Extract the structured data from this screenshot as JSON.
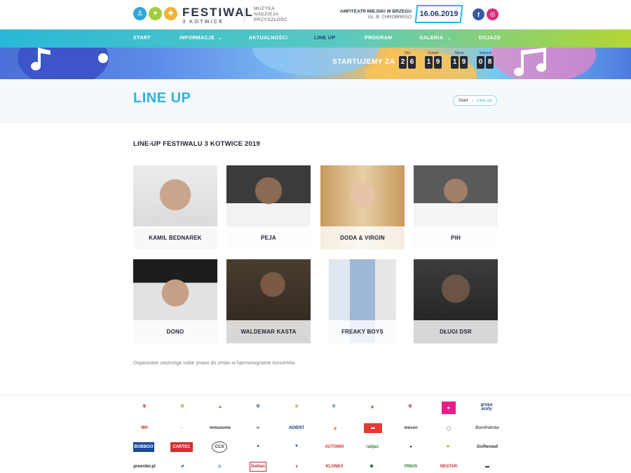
{
  "header": {
    "brand_title": "FESTIWAL",
    "brand_subtitle": "3 KOTWICE",
    "motto_lines": [
      "MUZYKA",
      "NADZIEJA",
      "PRZYSZŁOŚĆ"
    ],
    "venue_name": "AMFITEATR MIEJSKI W BRZEGU",
    "venue_address": "UL. B. CHROBREGO",
    "date": "16.06.2019",
    "social": [
      "facebook-icon",
      "instagram-icon"
    ]
  },
  "nav": {
    "items": [
      {
        "label": "START"
      },
      {
        "label": "INFORMACJE"
      },
      {
        "label": "AKTUALNOŚCI"
      },
      {
        "label": "LINE UP"
      },
      {
        "label": "PROGRAM"
      },
      {
        "label": "GALERIA"
      },
      {
        "label": "DOJAZD"
      }
    ]
  },
  "countdown": {
    "label": "STARTUJEMY ZA",
    "groups": [
      {
        "label": "Dni",
        "digits": [
          "2",
          "6"
        ]
      },
      {
        "label": "Godzin",
        "digits": [
          "1",
          "9"
        ]
      },
      {
        "label": "Minut",
        "digits": [
          "1",
          "9"
        ]
      },
      {
        "label": "Sekund",
        "digits": [
          "0",
          "8"
        ]
      }
    ]
  },
  "page": {
    "title": "LINE UP",
    "breadcrumb_start": "Start",
    "breadcrumb_current": "Line up"
  },
  "lineup": {
    "heading": "LINE-UP FESTIWALU 3 KOTWICE 2019",
    "artists": [
      {
        "name": "KAMIL BEDNAREK"
      },
      {
        "name": "PEJA"
      },
      {
        "name": "DODA & VIRGIN"
      },
      {
        "name": "PIH"
      },
      {
        "name": "DONO"
      },
      {
        "name": "WALDEMAR KASTA"
      },
      {
        "name": "FREAKY BOYS"
      },
      {
        "name": "DŁUGI DSR"
      }
    ],
    "note": "Organizator zastrzega sobie prawo do zmian w harmonogramie koncertów."
  },
  "sponsors": {
    "rows": [
      [
        "",
        "",
        "",
        "",
        "",
        "",
        "",
        "",
        "",
        "grupa azoty"
      ],
      [
        "MH",
        "",
        "mmsoume",
        "",
        "ADIENT",
        "",
        "",
        "meson",
        "",
        "Bonifratrów"
      ],
      [
        "BOBBOO",
        "CARTEC",
        "CCS",
        "",
        "",
        "AUTOMIX",
        "radjax",
        "",
        "",
        "SixRemedi"
      ],
      [
        "preorder.pl",
        "",
        "",
        "Deklan",
        "",
        "KLONEX",
        "",
        "PINUS",
        "NESTAR",
        ""
      ]
    ]
  },
  "colors": {
    "accent": "#29b3e6",
    "navy": "#1b3a74",
    "nav_gradient_start": "#29b8d8",
    "nav_gradient_end": "#b3d632"
  }
}
